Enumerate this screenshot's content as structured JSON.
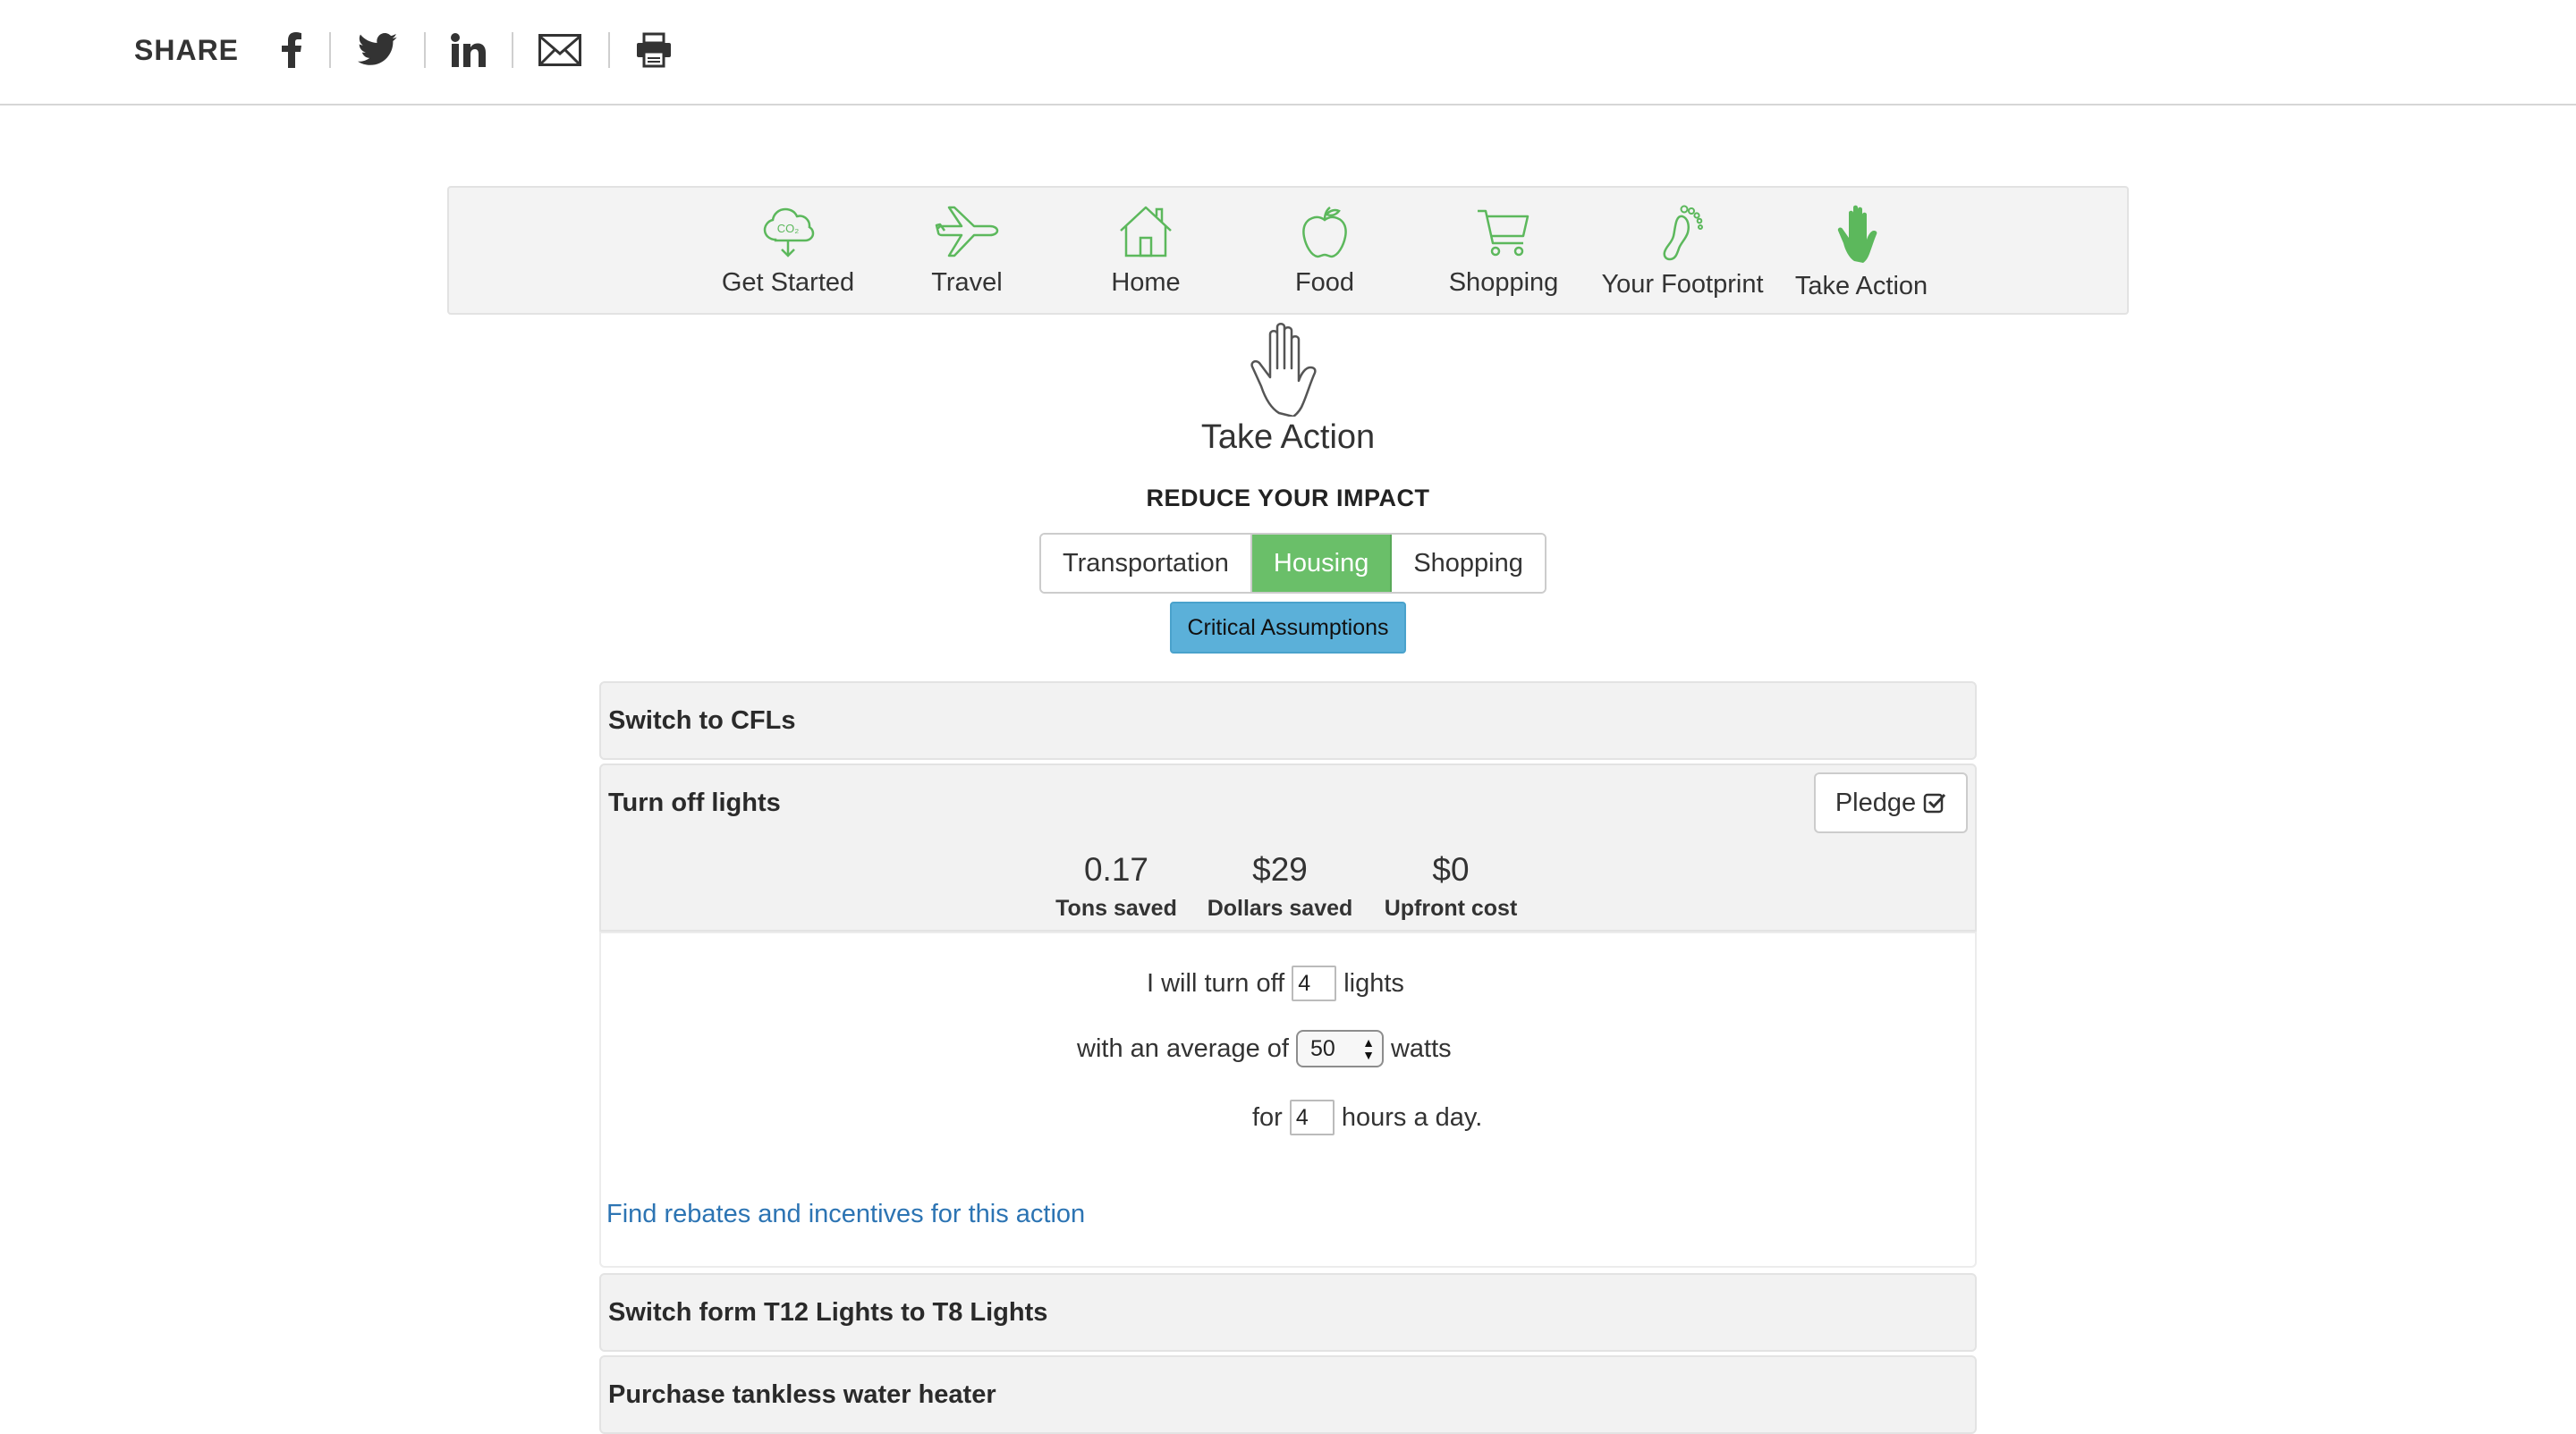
{
  "share": {
    "label": "SHARE",
    "icons": [
      "facebook-icon",
      "twitter-icon",
      "linkedin-icon",
      "email-icon",
      "print-icon"
    ]
  },
  "nav": {
    "accent": "#5cb85c",
    "items": [
      {
        "label": "Get Started",
        "icon": "co2-cloud-icon"
      },
      {
        "label": "Travel",
        "icon": "airplane-icon"
      },
      {
        "label": "Home",
        "icon": "house-icon"
      },
      {
        "label": "Food",
        "icon": "apple-icon"
      },
      {
        "label": "Shopping",
        "icon": "cart-icon"
      },
      {
        "label": "Your Footprint",
        "icon": "footprint-icon"
      },
      {
        "label": "Take Action",
        "icon": "hand-icon",
        "active": true
      }
    ]
  },
  "page": {
    "title": "Take Action",
    "section_heading": "REDUCE YOUR IMPACT"
  },
  "tabs": [
    {
      "label": "Transportation",
      "active": false
    },
    {
      "label": "Housing",
      "active": true
    },
    {
      "label": "Shopping",
      "active": false
    }
  ],
  "critical_assumptions_label": "Critical Assumptions",
  "actions": {
    "switch_cfls": "Switch to CFLs",
    "turn_off_lights": {
      "title": "Turn off lights",
      "pledge_label": "Pledge",
      "stats": [
        {
          "value": "0.17",
          "label": "Tons saved"
        },
        {
          "value": "$29",
          "label": "Dollars saved"
        },
        {
          "value": "$0",
          "label": "Upfront cost"
        }
      ],
      "form": {
        "row1_prefix": "I will turn off",
        "lights_count": "4",
        "row1_suffix": "lights",
        "row2_prefix": "with an average of",
        "watts_selected": "50",
        "row2_suffix": "watts",
        "row3_prefix": "for",
        "hours": "4",
        "row3_suffix": "hours a day."
      },
      "rebate_link": "Find rebates and incentives for this action"
    },
    "switch_t12": "Switch form T12 Lights to T8 Lights",
    "tankless": "Purchase tankless water heater"
  }
}
